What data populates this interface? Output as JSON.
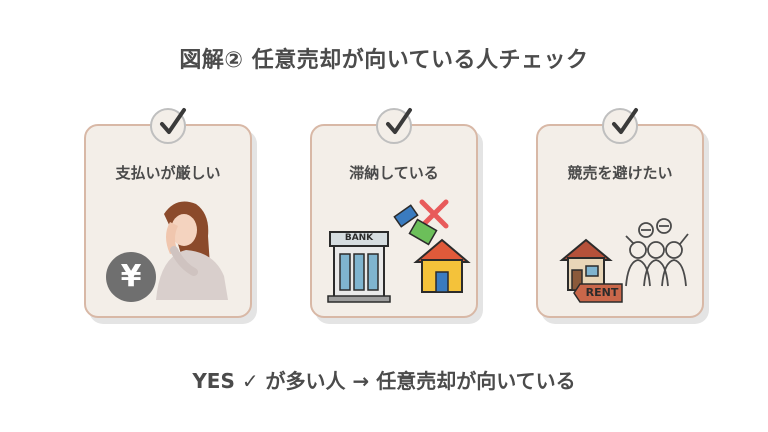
{
  "title": "図解② 任意売却が向いている人チェック",
  "cards": [
    {
      "label": "支払いが厳しい",
      "icon": "yen-coin-icon",
      "symbol": "¥"
    },
    {
      "label": "滞納している",
      "icon": "bank-house-icon",
      "bank_text": "BANK"
    },
    {
      "label": "競売を避けたい",
      "icon": "house-rent-crowd-icon",
      "rent_text": "RENT"
    }
  ],
  "footer": "YES ✓ が多い人 → 任意売却が向いている",
  "colors": {
    "card_bg": "#f3eee8",
    "card_border": "#d8b8a6",
    "text": "#4a4a4a"
  }
}
